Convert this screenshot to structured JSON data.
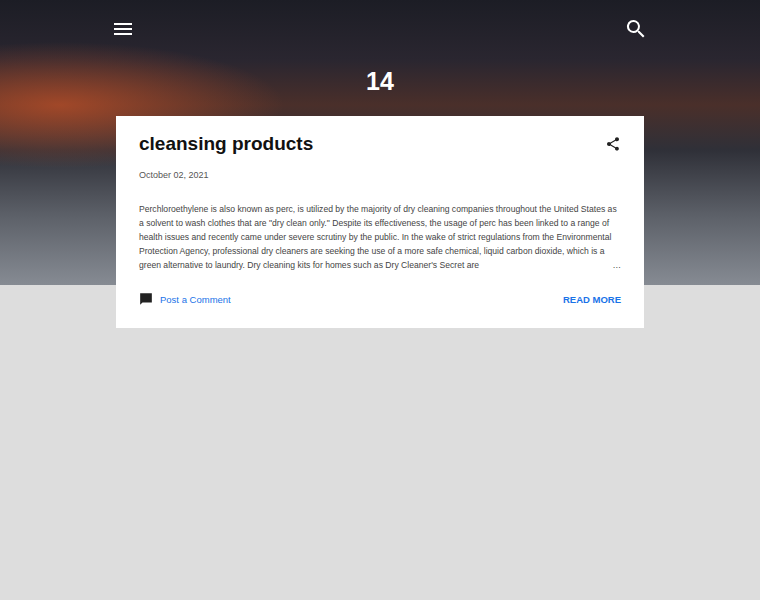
{
  "blog": {
    "title": "14"
  },
  "posts": [
    {
      "title": "cleansing products",
      "date": "October 02, 2021",
      "snippet": "Perchloroethylene is also known as perc, is utilized by the majority of dry cleaning companies throughout the United States as a solvent to wash clothes that are \"dry clean only.\" Despite its effectiveness, the usage of perc has been linked to a range of health issues and recently came under severe scrutiny by the public. In the wake of strict regulations from the Environmental Protection Agency, professional dry cleaners are seeking the use of a more safe chemical, liquid carbon dioxide, which is a green alternative to laundry. Dry cleaning kits for homes such as Dry Cleaner's Secret are",
      "ellipsis": "…",
      "comment_label": "Post a Comment",
      "read_more": "READ MORE"
    }
  ]
}
